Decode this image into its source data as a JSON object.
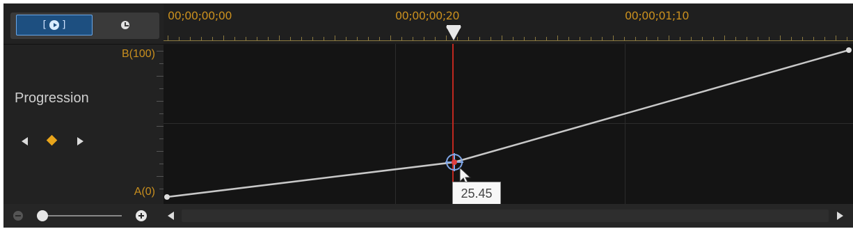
{
  "toolbar": {
    "mode_tabs": [
      {
        "name": "keyframe-mode",
        "icon": "play-circle-icon",
        "selected": true
      },
      {
        "name": "clock-mode",
        "icon": "clock-icon",
        "selected": false
      }
    ],
    "bracket_left": "[",
    "bracket_right": "]"
  },
  "property": {
    "label": "Progression"
  },
  "keyframe_nav": {
    "prev_icon": "triangle-left-icon",
    "keyframe_icon": "diamond-icon",
    "next_icon": "triangle-right-icon",
    "keyframe_color": "#e9a51b"
  },
  "value_axis": {
    "top_label": "B(100)",
    "bottom_label": "A(0)"
  },
  "timeline": {
    "timecodes": [
      "00;00;00;00",
      "00;00;00;20",
      "00;00;01;10"
    ],
    "playhead_timecode": "00;00;00;20"
  },
  "graph": {
    "tooltip_value": "25.45",
    "curve_color": "#c8c8c8",
    "playhead_color": "#c0281f",
    "keyframes": [
      {
        "time": "00;00;00;00",
        "value": 0
      },
      {
        "time": "00;00;00;20",
        "value": 25.45
      },
      {
        "time": "end",
        "value": 100
      }
    ]
  },
  "bottom_bar": {
    "zoom_out_icon": "minus-circle-icon",
    "zoom_in_icon": "plus-circle-icon",
    "scroll_left_icon": "triangle-left-icon",
    "scroll_right_icon": "triangle-right-icon",
    "zoom_level": 0.05
  },
  "colors": {
    "accent": "#c98f1e",
    "selected_tab": "#1d4f80"
  }
}
